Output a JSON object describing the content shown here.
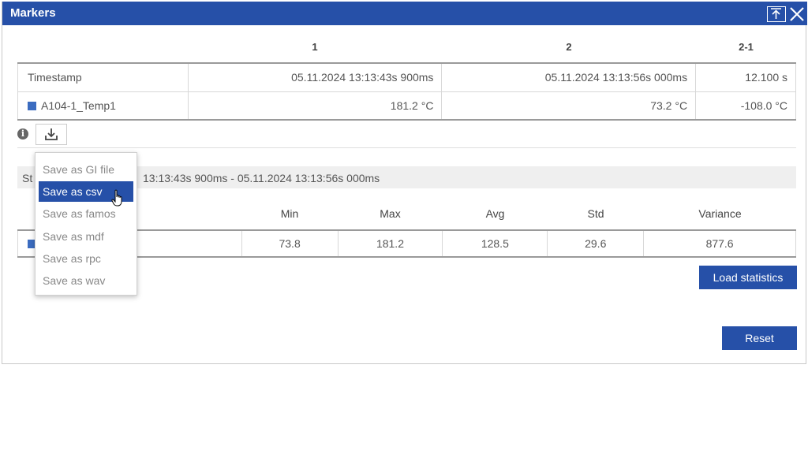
{
  "window": {
    "title": "Markers"
  },
  "markers": {
    "columns": [
      "1",
      "2",
      "2-1"
    ],
    "rows": [
      {
        "label": "Timestamp",
        "values": [
          "05.11.2024 13:13:43s 900ms",
          "05.11.2024 13:13:56s 000ms",
          "12.100 s"
        ]
      },
      {
        "label": "A104-1_Temp1",
        "values": [
          "181.2 °C",
          "73.2 °C",
          "-108.0 °C"
        ],
        "color": "#3b6cc0"
      }
    ]
  },
  "toolbar": {
    "info_icon_glyph": "i"
  },
  "download_menu": {
    "items": [
      "Save as GI file",
      "Save as csv",
      "Save as famos",
      "Save as mdf",
      "Save as rpc",
      "Save as wav"
    ],
    "selected": "Save as csv"
  },
  "statistics": {
    "range_prefix": "St",
    "range_text": "13:13:43s 900ms - 05.11.2024 13:13:56s 000ms",
    "columns": [
      "Min",
      "Max",
      "Avg",
      "Std",
      "Variance"
    ],
    "row": {
      "values": [
        "73.8",
        "181.2",
        "128.5",
        "29.6",
        "877.6"
      ],
      "color": "#3b6cc0"
    },
    "load_label": "Load statistics"
  },
  "footer": {
    "reset_label": "Reset"
  }
}
